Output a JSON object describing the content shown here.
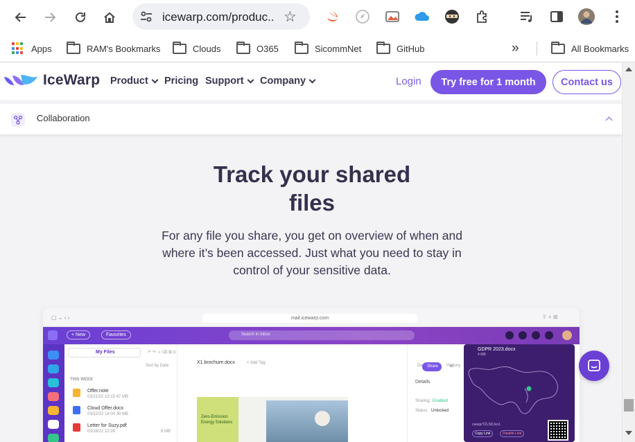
{
  "browser": {
    "url": "icewarp.com/produc...",
    "bookmarks": [
      "Apps",
      "RAM's Bookmarks",
      "Clouds",
      "O365",
      "SicommNet",
      "GitHub"
    ],
    "all_bookmarks": "All Bookmarks",
    "more_chevrons": "»"
  },
  "site": {
    "logo": "IceWarp",
    "nav": {
      "product": "Product",
      "pricing": "Pricing",
      "support": "Support",
      "company": "Company"
    },
    "login": "Login",
    "try_free": "Try free for 1 month",
    "contact": "Contact us",
    "accent": "#7a56e6"
  },
  "collab": {
    "label": "Collaboration"
  },
  "hero": {
    "title_line1": "Track your shared",
    "title_line2": "files",
    "text": "For any file you share, you get on overview of when and where it’s been accessed. Just what you need to stay in control of your sensitive data."
  },
  "mock": {
    "url": "mail.icewarp.com",
    "new_label": "+ New",
    "favorites": "Favorites",
    "search": "Search in Inbox",
    "my_files": "My Files",
    "share": "Share",
    "sort": "Sort by Date",
    "doc_name": "X1 brochure.docx",
    "add_tag": "+ Add Tag",
    "this_week": "THIS WEEK",
    "files": [
      {
        "name": "Offer.note",
        "meta": "03/21/22 13:15   47 MB"
      },
      {
        "name": "Cloud Offer.docx",
        "meta": "03/22/22 14:00   30 MB"
      },
      {
        "name": "Letter for Suzy.pdf",
        "meta": "03/18/22 12:39",
        "size": "8 MB"
      }
    ],
    "tabs": {
      "details": "Details",
      "history": "History"
    },
    "details_title": "Details",
    "sharing_label": "Sharing:",
    "sharing_value": "Enabled",
    "status_label": "Status:",
    "status_value": "Unlocked",
    "brochure_text": "Zero-Emission Energy Solutions",
    "map_file": "GDPR 2023.docx",
    "map_size": "4 MB",
    "copy_link": "Copy Link",
    "disable_link": "Disable Link",
    "link_text": "cwarp/T2LSDJxo1"
  }
}
